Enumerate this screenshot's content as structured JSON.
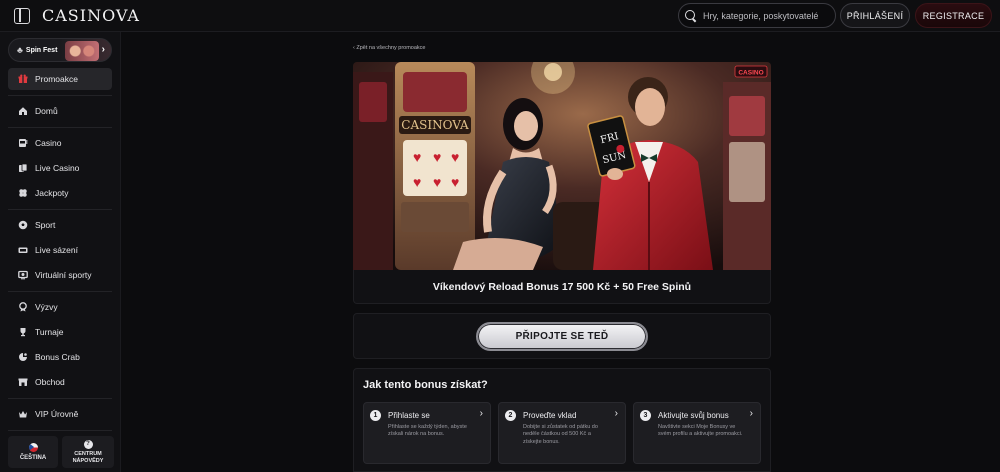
{
  "header": {
    "logo": "CASINOVA",
    "search_placeholder": "Hry, kategorie, poskytovatelé",
    "login_label": "PŘIHLÁŠENÍ",
    "register_label": "REGISTRACE"
  },
  "sidebar": {
    "promo_banner": "Spin Fest",
    "items": [
      {
        "label": "Promoakce",
        "icon": "gift-icon"
      },
      {
        "label": "Domů",
        "icon": "home-icon"
      },
      {
        "label": "Casino",
        "icon": "slot-icon"
      },
      {
        "label": "Live Casino",
        "icon": "cards-icon"
      },
      {
        "label": "Jackpoty",
        "icon": "clover-icon"
      },
      {
        "label": "Sport",
        "icon": "ball-icon"
      },
      {
        "label": "Live sázení",
        "icon": "live-icon"
      },
      {
        "label": "Virtuální sporty",
        "icon": "virtual-icon"
      },
      {
        "label": "Výzvy",
        "icon": "medal-icon"
      },
      {
        "label": "Turnaje",
        "icon": "trophy-icon"
      },
      {
        "label": "Bonus Crab",
        "icon": "crab-icon"
      },
      {
        "label": "Obchod",
        "icon": "shop-icon"
      },
      {
        "label": "VIP Úrovně",
        "icon": "vip-icon"
      }
    ],
    "language_label": "ČEŠTINA",
    "help_label_line1": "CENTRUM",
    "help_label_line2": "NÁPOVĚDY"
  },
  "main": {
    "back_link": "Zpět na všechny promoakce",
    "banner_badge": "CASINO",
    "banner_sign": "CASINOVA",
    "banner_card_line1": "FRI",
    "banner_card_line2": "SUN",
    "promo_title": "Víkendový Reload Bonus 17 500 Kč + 50 Free Spinů",
    "cta_label": "PŘIPOJTE SE TEĎ",
    "how_title": "Jak tento bonus získat?",
    "steps": [
      {
        "num": "1",
        "title": "Přihlaste se",
        "desc": "Přihlaste se každý týden, abyste získali nárok na bonus."
      },
      {
        "num": "2",
        "title": "Proveďte vklad",
        "desc": "Dobijte si zůstatek od pátku do neděle částkou od 500 Kč a získejte bonus."
      },
      {
        "num": "3",
        "title": "Aktivujte svůj bonus",
        "desc": "Navštivte sekci Moje Bonusy ve svém profilu a aktivujte promoakci."
      }
    ]
  },
  "colors": {
    "background": "#0c0c0e",
    "accent_red": "#e03a3f",
    "register_bg": "#2a0c10"
  }
}
